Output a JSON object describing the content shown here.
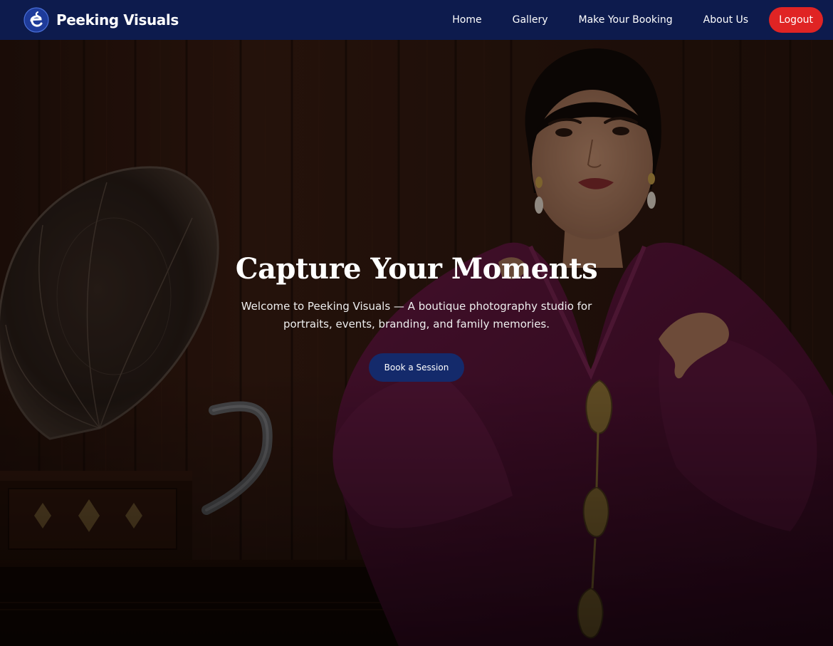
{
  "brand": {
    "name": "Peeking Visuals",
    "logo_icon": "peeking-visuals-logo"
  },
  "nav": {
    "links": [
      {
        "label": "Home"
      },
      {
        "label": "Gallery"
      },
      {
        "label": "Make Your Booking"
      },
      {
        "label": "About Us"
      }
    ],
    "logout_label": "Logout"
  },
  "hero": {
    "title": "Capture Your Moments",
    "subtitle": "Welcome to Peeking Visuals — A boutique photography studio for portraits, events, branding, and family memories.",
    "cta_label": "Book a Session",
    "background_image": "woman-in-plum-kebaya-beside-gramophone-photo"
  },
  "colors": {
    "navbar_bg": "#0d1b4d",
    "logout_bg": "#e02424",
    "cta_bg": "#142a6b",
    "dress": "#5a1438",
    "wood": "#3a1d12"
  }
}
